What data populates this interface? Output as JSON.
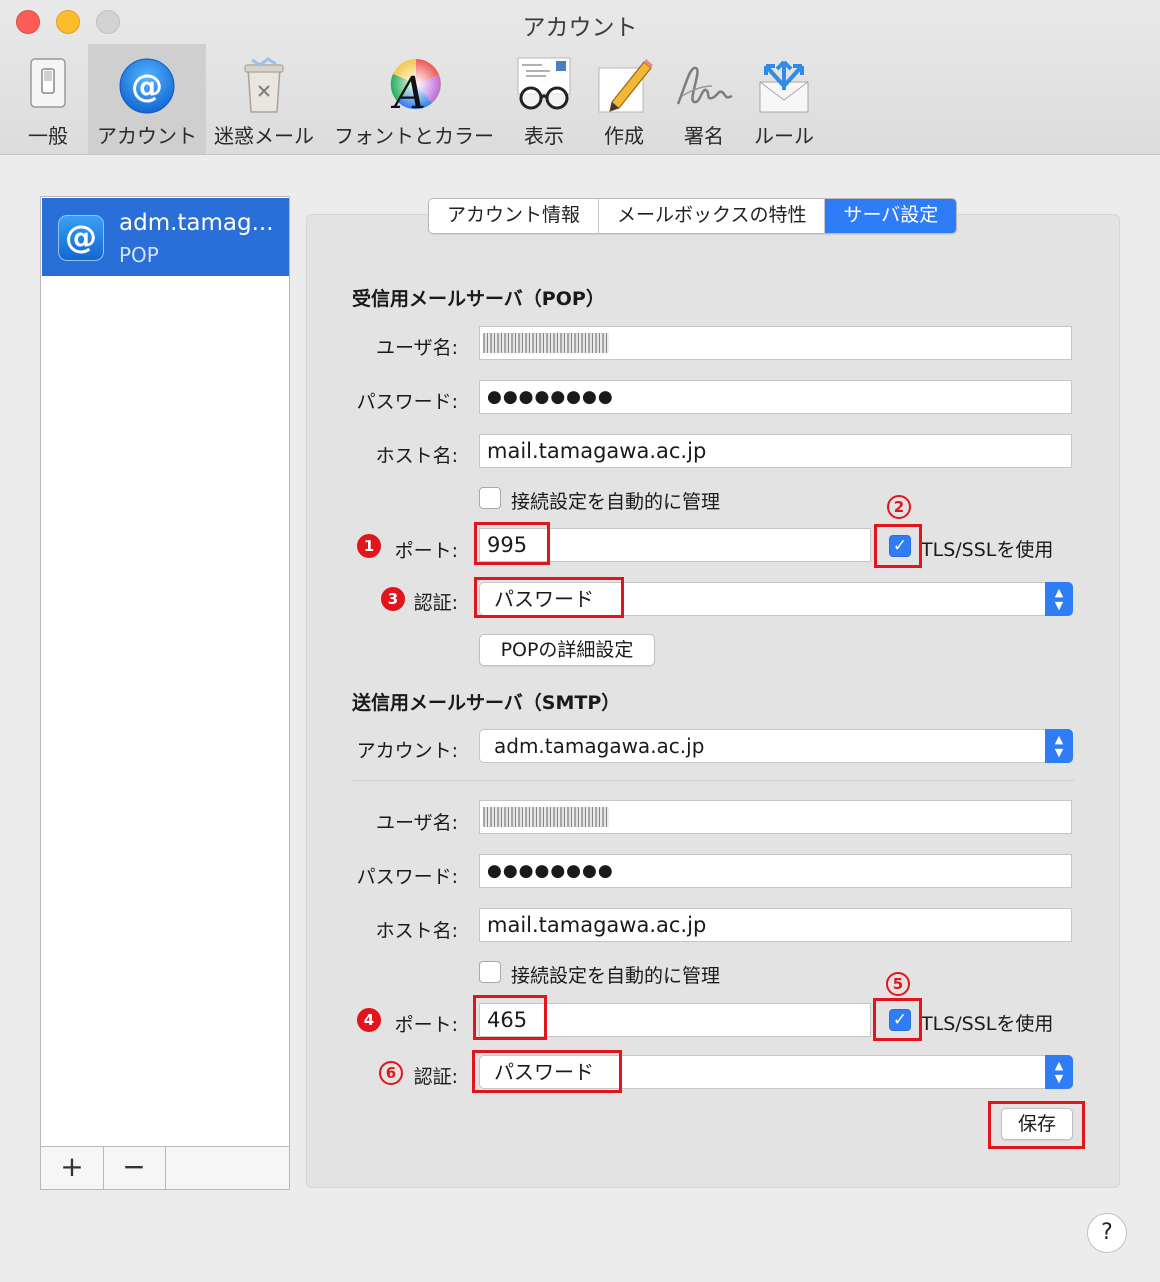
{
  "window": {
    "title": "アカウント"
  },
  "toolbar": {
    "items": [
      {
        "label": "一般",
        "icon": "switch-icon"
      },
      {
        "label": "アカウント",
        "icon": "at-icon"
      },
      {
        "label": "迷惑メール",
        "icon": "junk-bin-icon"
      },
      {
        "label": "フォントとカラー",
        "icon": "font-color-icon"
      },
      {
        "label": "表示",
        "icon": "glasses-icon"
      },
      {
        "label": "作成",
        "icon": "pencil-icon"
      },
      {
        "label": "署名",
        "icon": "signature-icon"
      },
      {
        "label": "ルール",
        "icon": "rules-envelope-icon"
      }
    ],
    "selected": "アカウント"
  },
  "sidebar": {
    "account": {
      "icon_text": "@",
      "name": "adm.tamag...",
      "type": "POP"
    },
    "add_label": "+",
    "remove_label": "−"
  },
  "tabs": [
    {
      "label": "アカウント情報"
    },
    {
      "label": "メールボックスの特性"
    },
    {
      "label": "サーバ設定",
      "selected": true
    }
  ],
  "incoming": {
    "heading": "受信用メールサーバ（POP）",
    "username_label": "ユーザ名:",
    "password_label": "パスワード:",
    "password_value": "●●●●●●●●",
    "host_label": "ホスト名:",
    "host_value": "mail.tamagawa.ac.jp",
    "auto_manage_label": "接続設定を自動的に管理",
    "port_label": "ポート:",
    "port_value": "995",
    "tls_label": "TLS/SSLを使用",
    "auth_label": "認証:",
    "auth_value": "パスワード",
    "advanced_button": "POPの詳細設定"
  },
  "outgoing": {
    "heading": "送信用メールサーバ（SMTP）",
    "account_label": "アカウント:",
    "account_value": "adm.tamagawa.ac.jp",
    "username_label": "ユーザ名:",
    "password_label": "パスワード:",
    "password_value": "●●●●●●●●",
    "host_label": "ホスト名:",
    "host_value": "mail.tamagawa.ac.jp",
    "auto_manage_label": "接続設定を自動的に管理",
    "port_label": "ポート:",
    "port_value": "465",
    "tls_label": "TLS/SSLを使用",
    "auth_label": "認証:",
    "auth_value": "パスワード"
  },
  "save_button": "保存",
  "help_button": "?",
  "annotations": {
    "marker_1": "1",
    "marker_2": "2",
    "marker_3": "3",
    "marker_4": "4",
    "marker_5": "5",
    "marker_6": "6",
    "color": "#e1151b"
  },
  "colors": {
    "accent": "#2f7df6",
    "selection": "#2a6fd8"
  }
}
